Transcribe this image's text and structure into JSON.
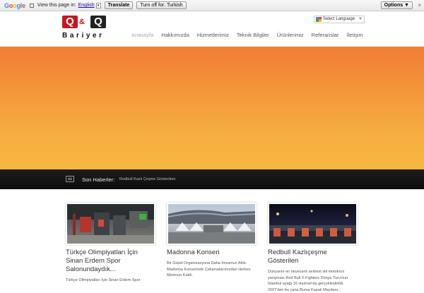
{
  "translate_bar": {
    "logo": "Google",
    "prompt": "View this page in:",
    "language": "English",
    "translate_btn": "Translate",
    "turn_off_btn": "Turn off for: Turkish",
    "options_btn": "Options ▼",
    "close": "×"
  },
  "header": {
    "logo_word": "Bariyer",
    "logo_q": "Q",
    "logo_amp": "&",
    "lang_select": "Select Language",
    "lang_arrow": "▼",
    "nav": [
      "Anasayfa",
      "Hakkımızda",
      "Hizmetlerimiz",
      "Teknik Bilgiler",
      "Ürünlerimiz",
      "Referanslar",
      "İletişim"
    ]
  },
  "hero": {
    "colors": [
      "#f07d34",
      "#f6b842"
    ]
  },
  "news": {
    "label": "Son Haberler:",
    "headline": "Redbull Kazlı Çeşme Gösterileri",
    "rss": "≋"
  },
  "cards": [
    {
      "title": "Türkçe Olimpiyatları İçin Sinan Erdem Spor Salonundaydık...",
      "text": "Türkçe Olimpiyatları İçin Sinan Erdem Spor"
    },
    {
      "title": "Madonna Konseri",
      "text": "Bir Güzel Organizasyona Daha İmzamızı Attık. Madonna Konserinde Çalışmalarımızdan Herkes Memnun Kaldı."
    },
    {
      "title": "Redbull Kazlıçeşme Gösterileri",
      "text": "Dünyanın en heyecanlı serbest stil motokros yarışması Red Bull X-Fighters Dünya Turu'nun İstanbul ayağı 16 Haziran'da gerçekleştirildi. 2007'den bu yana Bursa Kapalı Meydanı..."
    }
  ],
  "colors": {
    "accent": "#c8161d",
    "newsbar": "#111111"
  }
}
